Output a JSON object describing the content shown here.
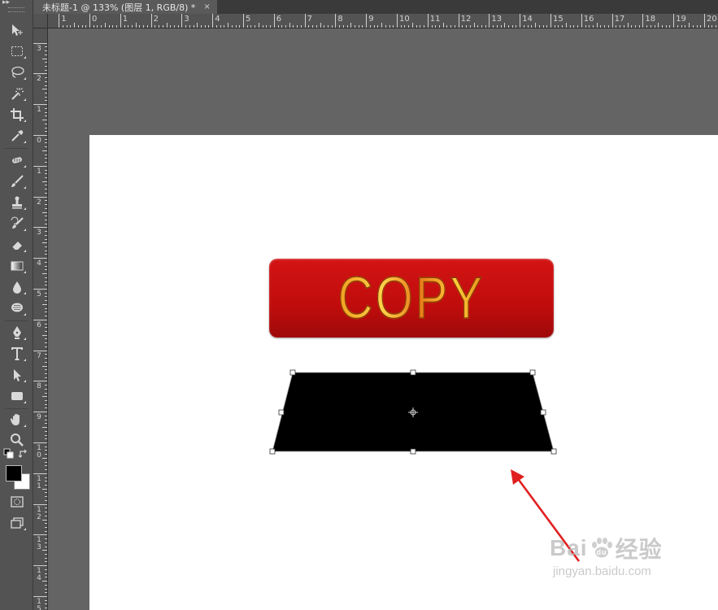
{
  "document_tab": {
    "title": "未标题-1 @ 133% (图层 1, RGB/8) *",
    "close_glyph": "×"
  },
  "rulers": {
    "top_labels": [
      "1",
      "0",
      "1",
      "2",
      "3",
      "4",
      "5",
      "6",
      "7",
      "8",
      "9",
      "10",
      "11",
      "12",
      "13",
      "14",
      "15",
      "16",
      "17",
      "18",
      "19",
      "20"
    ],
    "left_labels": [
      "3",
      "2",
      "1",
      "0",
      "1",
      "2",
      "3",
      "4",
      "5",
      "6",
      "7",
      "8",
      "9",
      "1 0",
      "1 1",
      "1 2",
      "1 3",
      "1 4",
      "1 5"
    ]
  },
  "toolbar": {
    "tools": [
      "move-tool",
      "marquee-tool",
      "lasso-tool",
      "magic-wand-tool",
      "crop-tool",
      "eyedropper-tool",
      "healing-brush-tool",
      "brush-tool",
      "clone-stamp-tool",
      "history-brush-tool",
      "eraser-tool",
      "gradient-tool",
      "blur-tool",
      "dodge-tool",
      "pen-tool",
      "type-tool",
      "path-selection-tool",
      "rectangle-tool",
      "hand-tool",
      "zoom-tool"
    ],
    "foreground_color": "#000000",
    "background_color": "#ffffff"
  },
  "canvas": {
    "button_text": "COPY",
    "button_color": "#c81010",
    "shape_fill": "#000000",
    "arrow_color": "#e02020"
  },
  "watermark": {
    "brand_left": "Bai",
    "brand_right": "经验",
    "url": "jingyan.baidu.com"
  }
}
